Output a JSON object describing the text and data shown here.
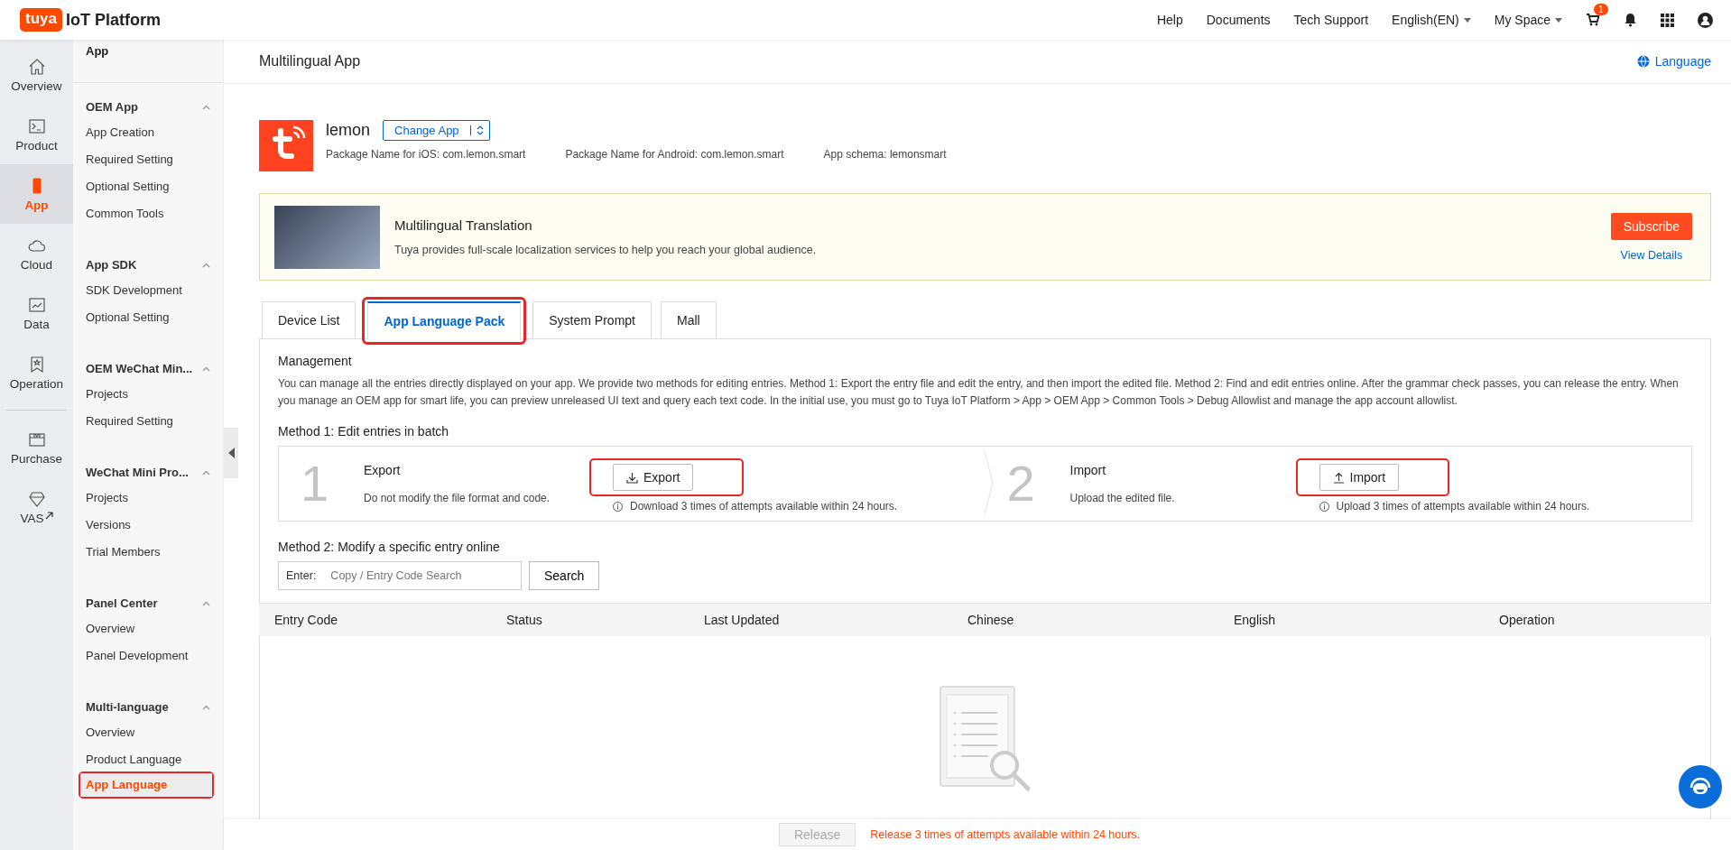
{
  "topbar": {
    "logo": "tuya",
    "brand": "IoT Platform",
    "links": [
      "Help",
      "Documents",
      "Tech Support"
    ],
    "dropdowns": [
      "English(EN)",
      "My Space"
    ],
    "cart_badge": "1"
  },
  "rail": [
    {
      "label": "Overview",
      "selected": false,
      "external": false
    },
    {
      "label": "Product",
      "selected": false,
      "external": false
    },
    {
      "label": "App",
      "selected": true,
      "external": false
    },
    {
      "label": "Cloud",
      "selected": false,
      "external": false
    },
    {
      "label": "Data",
      "selected": false,
      "external": false
    },
    {
      "label": "Operation",
      "selected": false,
      "external": false
    },
    {
      "label": "Purchase",
      "selected": false,
      "external": false
    },
    {
      "label": "VAS",
      "selected": false,
      "external": true
    }
  ],
  "nav": {
    "title": "App",
    "groups": [
      {
        "title": "OEM App",
        "expanded": true,
        "items": [
          {
            "label": "App Creation",
            "selected": false,
            "highlighted": false
          },
          {
            "label": "Required Setting",
            "selected": false,
            "highlighted": false
          },
          {
            "label": "Optional Setting",
            "selected": false,
            "highlighted": false
          },
          {
            "label": "Common Tools",
            "selected": false,
            "highlighted": false
          }
        ]
      },
      {
        "title": "App SDK",
        "expanded": true,
        "items": [
          {
            "label": "SDK Development",
            "selected": false,
            "highlighted": false
          },
          {
            "label": "Optional Setting",
            "selected": false,
            "highlighted": false
          }
        ]
      },
      {
        "title": "OEM WeChat Min...",
        "expanded": true,
        "items": [
          {
            "label": "Projects",
            "selected": false,
            "highlighted": false
          },
          {
            "label": "Required Setting",
            "selected": false,
            "highlighted": false
          }
        ]
      },
      {
        "title": "WeChat Mini Pro...",
        "expanded": true,
        "items": [
          {
            "label": "Projects",
            "selected": false,
            "highlighted": false
          },
          {
            "label": "Versions",
            "selected": false,
            "highlighted": false
          },
          {
            "label": "Trial Members",
            "selected": false,
            "highlighted": false
          }
        ]
      },
      {
        "title": "Panel Center",
        "expanded": true,
        "items": [
          {
            "label": "Overview",
            "selected": false,
            "highlighted": false
          },
          {
            "label": "Panel Development",
            "selected": false,
            "highlighted": false
          }
        ]
      },
      {
        "title": "Multi-language",
        "expanded": true,
        "items": [
          {
            "label": "Overview",
            "selected": false,
            "highlighted": false
          },
          {
            "label": "Product Language",
            "selected": false,
            "highlighted": false
          },
          {
            "label": "App Language",
            "selected": true,
            "highlighted": true
          }
        ]
      }
    ]
  },
  "header": {
    "title": "Multilingual App",
    "language_link": "Language"
  },
  "app": {
    "name": "lemon",
    "change_button": "Change App",
    "ios": "Package Name for iOS: com.lemon.smart",
    "android": "Package Name for Android: com.lemon.smart",
    "schema": "App schema: lemonsmart"
  },
  "banner": {
    "title": "Multilingual Translation",
    "text": "Tuya provides full-scale localization services to help you reach your global audience.",
    "subscribe": "Subscribe",
    "view_details": "View Details"
  },
  "tabs": [
    {
      "label": "Device List",
      "selected": false,
      "highlighted": false
    },
    {
      "label": "App Language Pack",
      "selected": true,
      "highlighted": true
    },
    {
      "label": "System Prompt",
      "selected": false,
      "highlighted": false
    },
    {
      "label": "Mall",
      "selected": false,
      "highlighted": false
    }
  ],
  "management": {
    "title": "Management",
    "text": "You can manage all the entries directly displayed on your app. We provide two methods for editing entries. Method 1: Export the entry file and edit the entry, and then import the edited file. Method 2: Find and edit entries online. After the grammar check passes, you can release the entry. When you manage an OEM app for smart life, you can preview unreleased UI text and query each text code. In the initial use, you must go to Tuya IoT Platform > App > OEM App > Common Tools > Debug Allowlist and manage the app account allowlist."
  },
  "method1": {
    "title": "Method 1: Edit entries in batch",
    "steps": [
      {
        "kind": "download",
        "number": "1",
        "title": "Export",
        "text": "Do not modify the file format and code.",
        "button": "Export",
        "hint": "Download 3 times of attempts available within 24 hours.",
        "highlighted": true
      },
      {
        "kind": "upload",
        "number": "2",
        "title": "Import",
        "text": "Upload the edited file.",
        "button": "Import",
        "hint": "Upload 3 times of attempts available within 24 hours.",
        "highlighted": true
      }
    ]
  },
  "method2": {
    "title": "Method 2: Modify a specific entry online",
    "label": "Enter:",
    "placeholder": "Copy / Entry Code Search",
    "button": "Search"
  },
  "table": {
    "columns": [
      "Entry Code",
      "Status",
      "Last Updated",
      "Chinese",
      "English",
      "Operation"
    ]
  },
  "footer": {
    "release": "Release",
    "release_disabled": true,
    "note": "Release 3 times of attempts available within 24 hours."
  }
}
